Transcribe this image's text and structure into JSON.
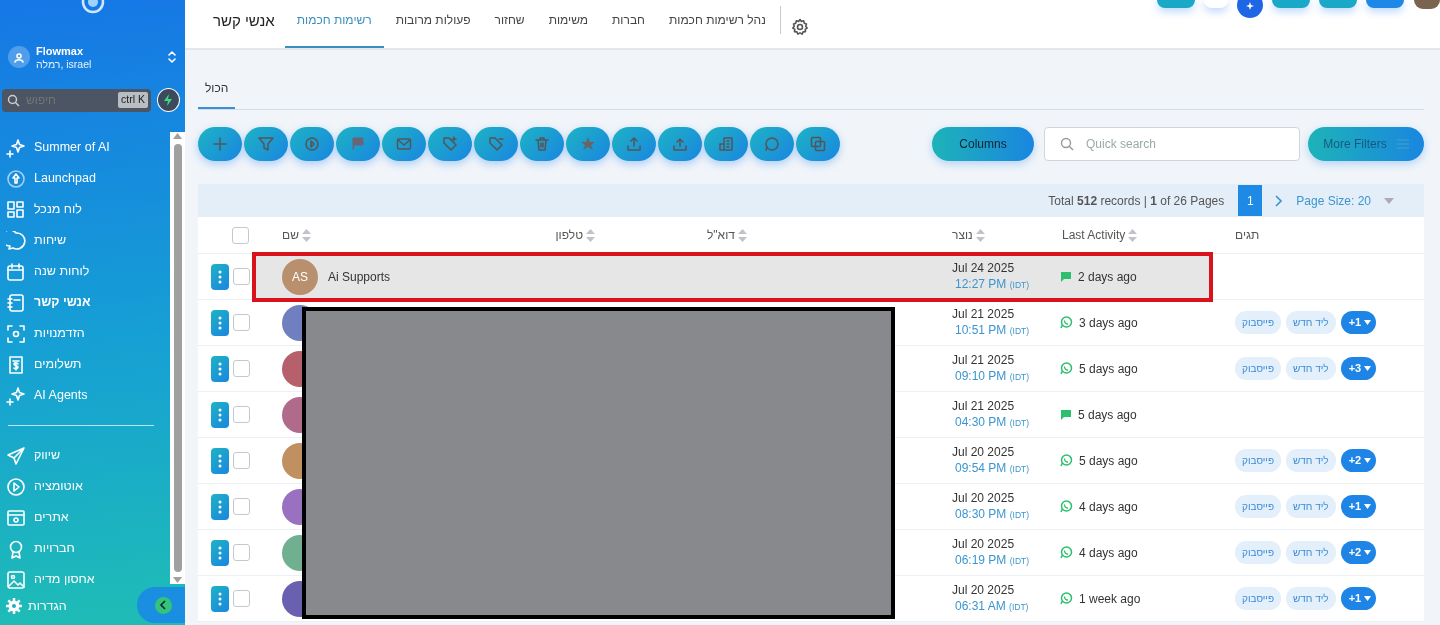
{
  "sidebar": {
    "account": {
      "name": "Flowmax",
      "location": "רמלה, israel"
    },
    "search": {
      "placeholder": "חיפוש",
      "shortcut": "ctrl K"
    },
    "items": [
      {
        "label": "Summer of AI",
        "selected": false
      },
      {
        "label": "Launchpad",
        "selected": false
      },
      {
        "label": "לוח מנכל",
        "selected": false
      },
      {
        "label": "שיחות",
        "selected": false
      },
      {
        "label": "לוחות שנה",
        "selected": false
      },
      {
        "label": "אנשי קשר",
        "selected": true
      },
      {
        "label": "הזדמנויות",
        "selected": false
      },
      {
        "label": "תשלומים",
        "selected": false
      },
      {
        "label": "AI Agents",
        "selected": false
      }
    ],
    "items_2": [
      {
        "label": "שיווק",
        "selected": false
      },
      {
        "label": "אוטומציה",
        "selected": false
      },
      {
        "label": "אתרים",
        "selected": false
      },
      {
        "label": "חברויות",
        "selected": false
      },
      {
        "label": "אחסון מדיה",
        "selected": false
      }
    ],
    "settings": "הגדרות"
  },
  "header": {
    "tabs": [
      {
        "label": "נהל רשימות חכמות",
        "selected": false
      },
      {
        "label": "חברות",
        "selected": false
      },
      {
        "label": "משימות",
        "selected": false
      },
      {
        "label": "שחזור",
        "selected": false
      },
      {
        "label": "פעולות מרובות",
        "selected": false
      },
      {
        "label": "רשימות חכמות",
        "selected": true
      }
    ],
    "title": "אנשי קשר"
  },
  "subtabs": [
    {
      "label": "הכול",
      "selected": true
    }
  ],
  "toolbar": {
    "columns_button": "Columns",
    "search": {
      "placeholder": "Quick search"
    },
    "more_filters": "More Filters"
  },
  "pagination": {
    "summary": "Total **512** records | **1** of 26 Pages",
    "pages": [
      {
        "label": "1",
        "selected": true
      }
    ],
    "page_size": "Page Size: 20"
  },
  "table": {
    "select_all_checked": false,
    "columns": [
      {
        "label": "תגים",
        "sortable": false
      },
      {
        "label": "Last Activity",
        "sortable": true
      },
      {
        "label": "נוצר",
        "sortable": true
      },
      {
        "label": "דוא\"ל",
        "sortable": true
      },
      {
        "label": "טלפון",
        "sortable": true
      },
      {
        "label": "שם",
        "sortable": true
      }
    ],
    "rows": [
      {
        "kind": "message",
        "checked": false,
        "initials": "AS",
        "color": "#b8906e",
        "name": "Ai Supports",
        "created_date": "Jul 24 2025",
        "created_time": "12:27 PM",
        "timezone": "(IDT)",
        "activity": "2 days ago",
        "tags": [],
        "highlighted": true,
        "redacted": false
      },
      {
        "kind": "whatsapp",
        "checked": false,
        "color": "#6f7fc0",
        "created_date": "Jul 21 2025",
        "created_time": "10:51 PM",
        "timezone": "(IDT)",
        "activity": "3 days ago",
        "tags": [
          "ליד חדש",
          "פייסבוק"
        ],
        "more": "+1",
        "highlighted": false,
        "redacted": true
      },
      {
        "kind": "whatsapp",
        "checked": false,
        "color": "#b5606a",
        "created_date": "Jul 21 2025",
        "created_time": "09:10 PM",
        "timezone": "(IDT)",
        "activity": "5 days ago",
        "tags": [
          "ליד חדש",
          "פייסבוק"
        ],
        "more": "+3",
        "highlighted": false,
        "redacted": true
      },
      {
        "kind": "message",
        "checked": false,
        "color": "#b06a8a",
        "created_date": "Jul 21 2025",
        "created_time": "04:30 PM",
        "timezone": "(IDT)",
        "activity": "5 days ago",
        "tags": [],
        "highlighted": false,
        "redacted": true
      },
      {
        "kind": "whatsapp",
        "checked": false,
        "color": "#c09060",
        "created_date": "Jul 20 2025",
        "created_time": "09:54 PM",
        "timezone": "(IDT)",
        "activity": "5 days ago",
        "tags": [
          "ליד חדש",
          "פייסבוק"
        ],
        "more": "+2",
        "highlighted": false,
        "redacted": true
      },
      {
        "kind": "whatsapp",
        "checked": false,
        "color": "#9a70c0",
        "created_date": "Jul 20 2025",
        "created_time": "08:30 PM",
        "timezone": "(IDT)",
        "activity": "4 days ago",
        "tags": [
          "ליד חדש",
          "פייסבוק"
        ],
        "more": "+1",
        "highlighted": false,
        "redacted": true
      },
      {
        "kind": "whatsapp",
        "checked": false,
        "color": "#70b090",
        "created_date": "Jul 20 2025",
        "created_time": "06:19 PM",
        "timezone": "(IDT)",
        "activity": "4 days ago",
        "tags": [
          "ליד חדש",
          "פייסבוק"
        ],
        "more": "+2",
        "highlighted": false,
        "redacted": true
      },
      {
        "kind": "whatsapp",
        "checked": false,
        "color": "#6a60b0",
        "created_date": "Jul 20 2025",
        "created_time": "06:31 AM",
        "timezone": "(IDT)",
        "activity": "1 week ago",
        "tags": [
          "ליד חדש",
          "פייסבוק"
        ],
        "more": "+1",
        "highlighted": false,
        "redacted": true
      }
    ]
  }
}
